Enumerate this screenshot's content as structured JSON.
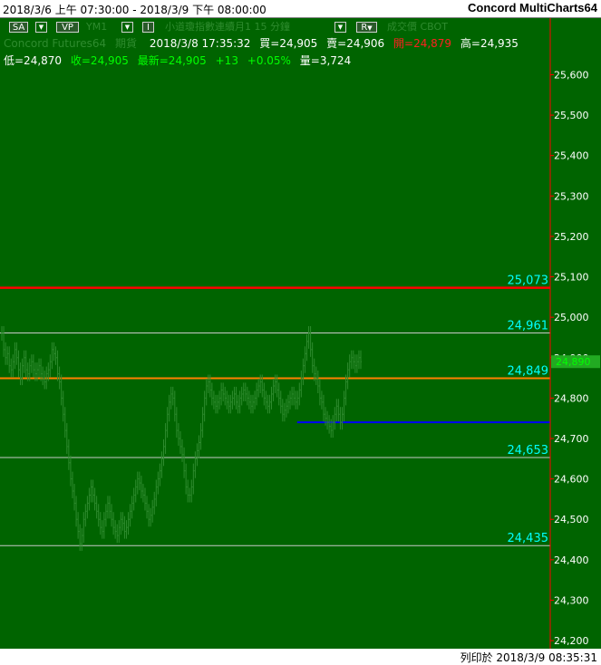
{
  "window": {
    "range_text": "2018/3/6 上午 07:30:00 - 2018/3/9 下午 08:00:00",
    "app_title": "Concord MultiCharts64"
  },
  "toolbar": {
    "sa_label": "SA",
    "vp_label": "VP",
    "symbol": "YM1",
    "indicator_btn": "I",
    "description": "小道瓊指數連續月1 15 分鐘",
    "r_btn": "R",
    "mode": "成交價 CBOT",
    "source": "Concord Futures64",
    "category": "期貨"
  },
  "quote": {
    "datetime": "2018/3/8  17:35:32",
    "bid": "買=24,905",
    "ask": "賣=24,906",
    "open": "開=24,879",
    "high": "高=24,935",
    "low": "低=24,870",
    "close": "收=24,905",
    "last": "最新=24,905",
    "change": "+13",
    "change_pct": "+0.05%",
    "volume": "量=3,724"
  },
  "footer": {
    "print_text": "列印於 2018/3/9 08:35:31"
  },
  "colors": {
    "background": "#006400",
    "axis_line": "#ff0000",
    "red_level": "#ff0000",
    "orange_level": "#ff8000",
    "blue_level": "#0000ff",
    "grey_level": "#c8c8c8",
    "level_text": "#00ffff"
  },
  "chart_data": {
    "type": "bar",
    "ylim": [
      24180,
      25740
    ],
    "y_ticks": [
      "25,600",
      "25,500",
      "25,400",
      "25,300",
      "25,200",
      "25,100",
      "25,000",
      "24,900",
      "24,800",
      "24,700",
      "24,600",
      "24,500",
      "24,400",
      "24,300",
      "24,200"
    ],
    "y_tick_values": [
      25600,
      25500,
      25400,
      25300,
      25200,
      25100,
      25000,
      24900,
      24800,
      24700,
      24600,
      24500,
      24400,
      24300,
      24200
    ],
    "last_price_tag": "24,890",
    "last_price_value": 24890,
    "levels": [
      {
        "label": "25,073",
        "value": 25073,
        "style": "red"
      },
      {
        "label": "24,961",
        "value": 24961,
        "style": "grey"
      },
      {
        "label": "24,849",
        "value": 24849,
        "style": "orange"
      },
      {
        "label": "24,653",
        "value": 24653,
        "style": "grey"
      },
      {
        "label": "24,435",
        "value": 24435,
        "style": "grey"
      }
    ],
    "blue_level": {
      "value": 24740,
      "x_start_fraction": 0.54
    },
    "series": [
      {
        "values": [
          24960,
          24920,
          24900,
          24910,
          24880,
          24870,
          24890,
          24920,
          24900,
          24870,
          24850,
          24880,
          24900,
          24870,
          24860,
          24880,
          24890,
          24870,
          24860,
          24870,
          24880,
          24860,
          24850,
          24840,
          24860,
          24870,
          24890,
          24920,
          24910,
          24900,
          24860,
          24840,
          24800,
          24760,
          24720,
          24680,
          24640,
          24600,
          24570,
          24540,
          24500,
          24470,
          24440,
          24460,
          24500,
          24520,
          24540,
          24560,
          24580,
          24560,
          24540,
          24520,
          24500,
          24480,
          24470,
          24500,
          24520,
          24540,
          24520,
          24500,
          24480,
          24470,
          24460,
          24480,
          24500,
          24490,
          24470,
          24480,
          24500,
          24520,
          24540,
          24560,
          24580,
          24600,
          24590,
          24570,
          24560,
          24540,
          24520,
          24500,
          24510,
          24530,
          24550,
          24580,
          24600,
          24620,
          24650,
          24680,
          24720,
          24760,
          24790,
          24810,
          24800,
          24760,
          24720,
          24700,
          24680,
          24660,
          24620,
          24580,
          24560,
          24560,
          24580,
          24620,
          24650,
          24670,
          24690,
          24720,
          24760,
          24800,
          24830,
          24840,
          24820,
          24800,
          24790,
          24780,
          24790,
          24800,
          24820,
          24810,
          24800,
          24790,
          24780,
          24790,
          24800,
          24810,
          24790,
          24780,
          24800,
          24810,
          24820,
          24810,
          24800,
          24790,
          24780,
          24790,
          24800,
          24820,
          24830,
          24840,
          24820,
          24800,
          24790,
          24780,
          24790,
          24810,
          24830,
          24840,
          24820,
          24800,
          24780,
          24760,
          24770,
          24780,
          24790,
          24800,
          24810,
          24800,
          24790,
          24800,
          24820,
          24850,
          24880,
          24910,
          24940,
          24960,
          24920,
          24880,
          24860,
          24850,
          24830,
          24800,
          24790,
          24760,
          24750,
          24740,
          24730,
          24720,
          24740,
          24760,
          24780,
          24760,
          24740,
          24760,
          24800,
          24840,
          24870,
          24890,
          24900,
          24890,
          24880,
          24890,
          24900,
          24890
        ]
      }
    ]
  }
}
